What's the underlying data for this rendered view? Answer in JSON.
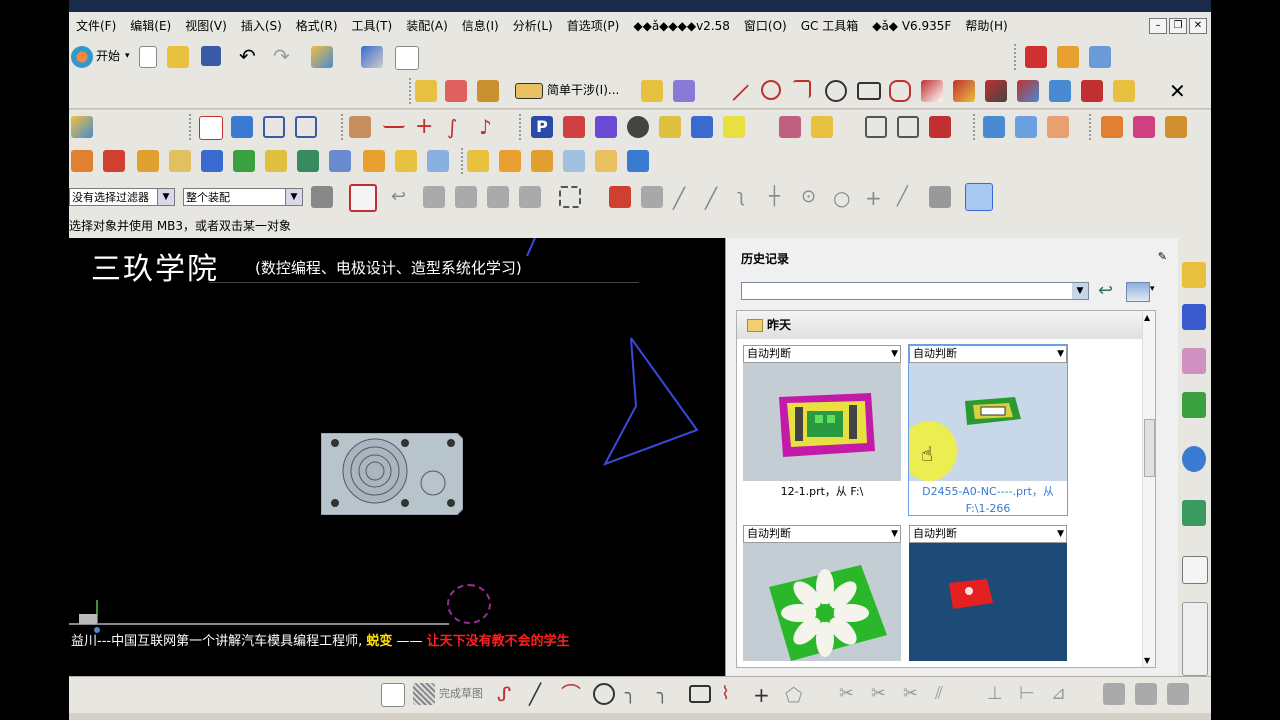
{
  "menubar": {
    "items": [
      "文件(F)",
      "编辑(E)",
      "视图(V)",
      "插入(S)",
      "格式(R)",
      "工具(T)",
      "装配(A)",
      "信息(I)",
      "分析(L)",
      "首选项(P)",
      "◆◆ǎ◆◆◆◆v2.58",
      "窗口(O)",
      "GC 工具箱",
      "◆ǎ◆ V6.935F",
      "帮助(H)"
    ]
  },
  "toolbar": {
    "start_label": "开始",
    "snap_label": "简单干涉(I)..."
  },
  "filterbar": {
    "filter_value": "没有选择过滤器",
    "assembly_value": "整个装配"
  },
  "cue": {
    "text": "选择对象并使用 MB3，或者双击某一对象"
  },
  "viewport": {
    "brand": "三玖学院",
    "brand_sub": "(数控编程、电极设计、造型系统化学习)",
    "footer_prefix": "益川---中国互联网第一个讲解汽车模具编程工程师,",
    "footer_highlight": "蜕变",
    "footer_dash": "——",
    "footer_red": "让天下没有教不会的学生"
  },
  "history": {
    "title": "历史记录",
    "group": "昨天",
    "cards": [
      {
        "select": "自动判断",
        "caption": "12-1.prt，从 F:\\"
      },
      {
        "select": "自动判断",
        "caption": "D2455-A0-NC----.prt，从 F:\\1-266"
      },
      {
        "select": "自动判断",
        "caption": ""
      },
      {
        "select": "自动判断",
        "caption": ""
      }
    ]
  },
  "bottombar": {
    "finish_sketch": "完成草图"
  }
}
